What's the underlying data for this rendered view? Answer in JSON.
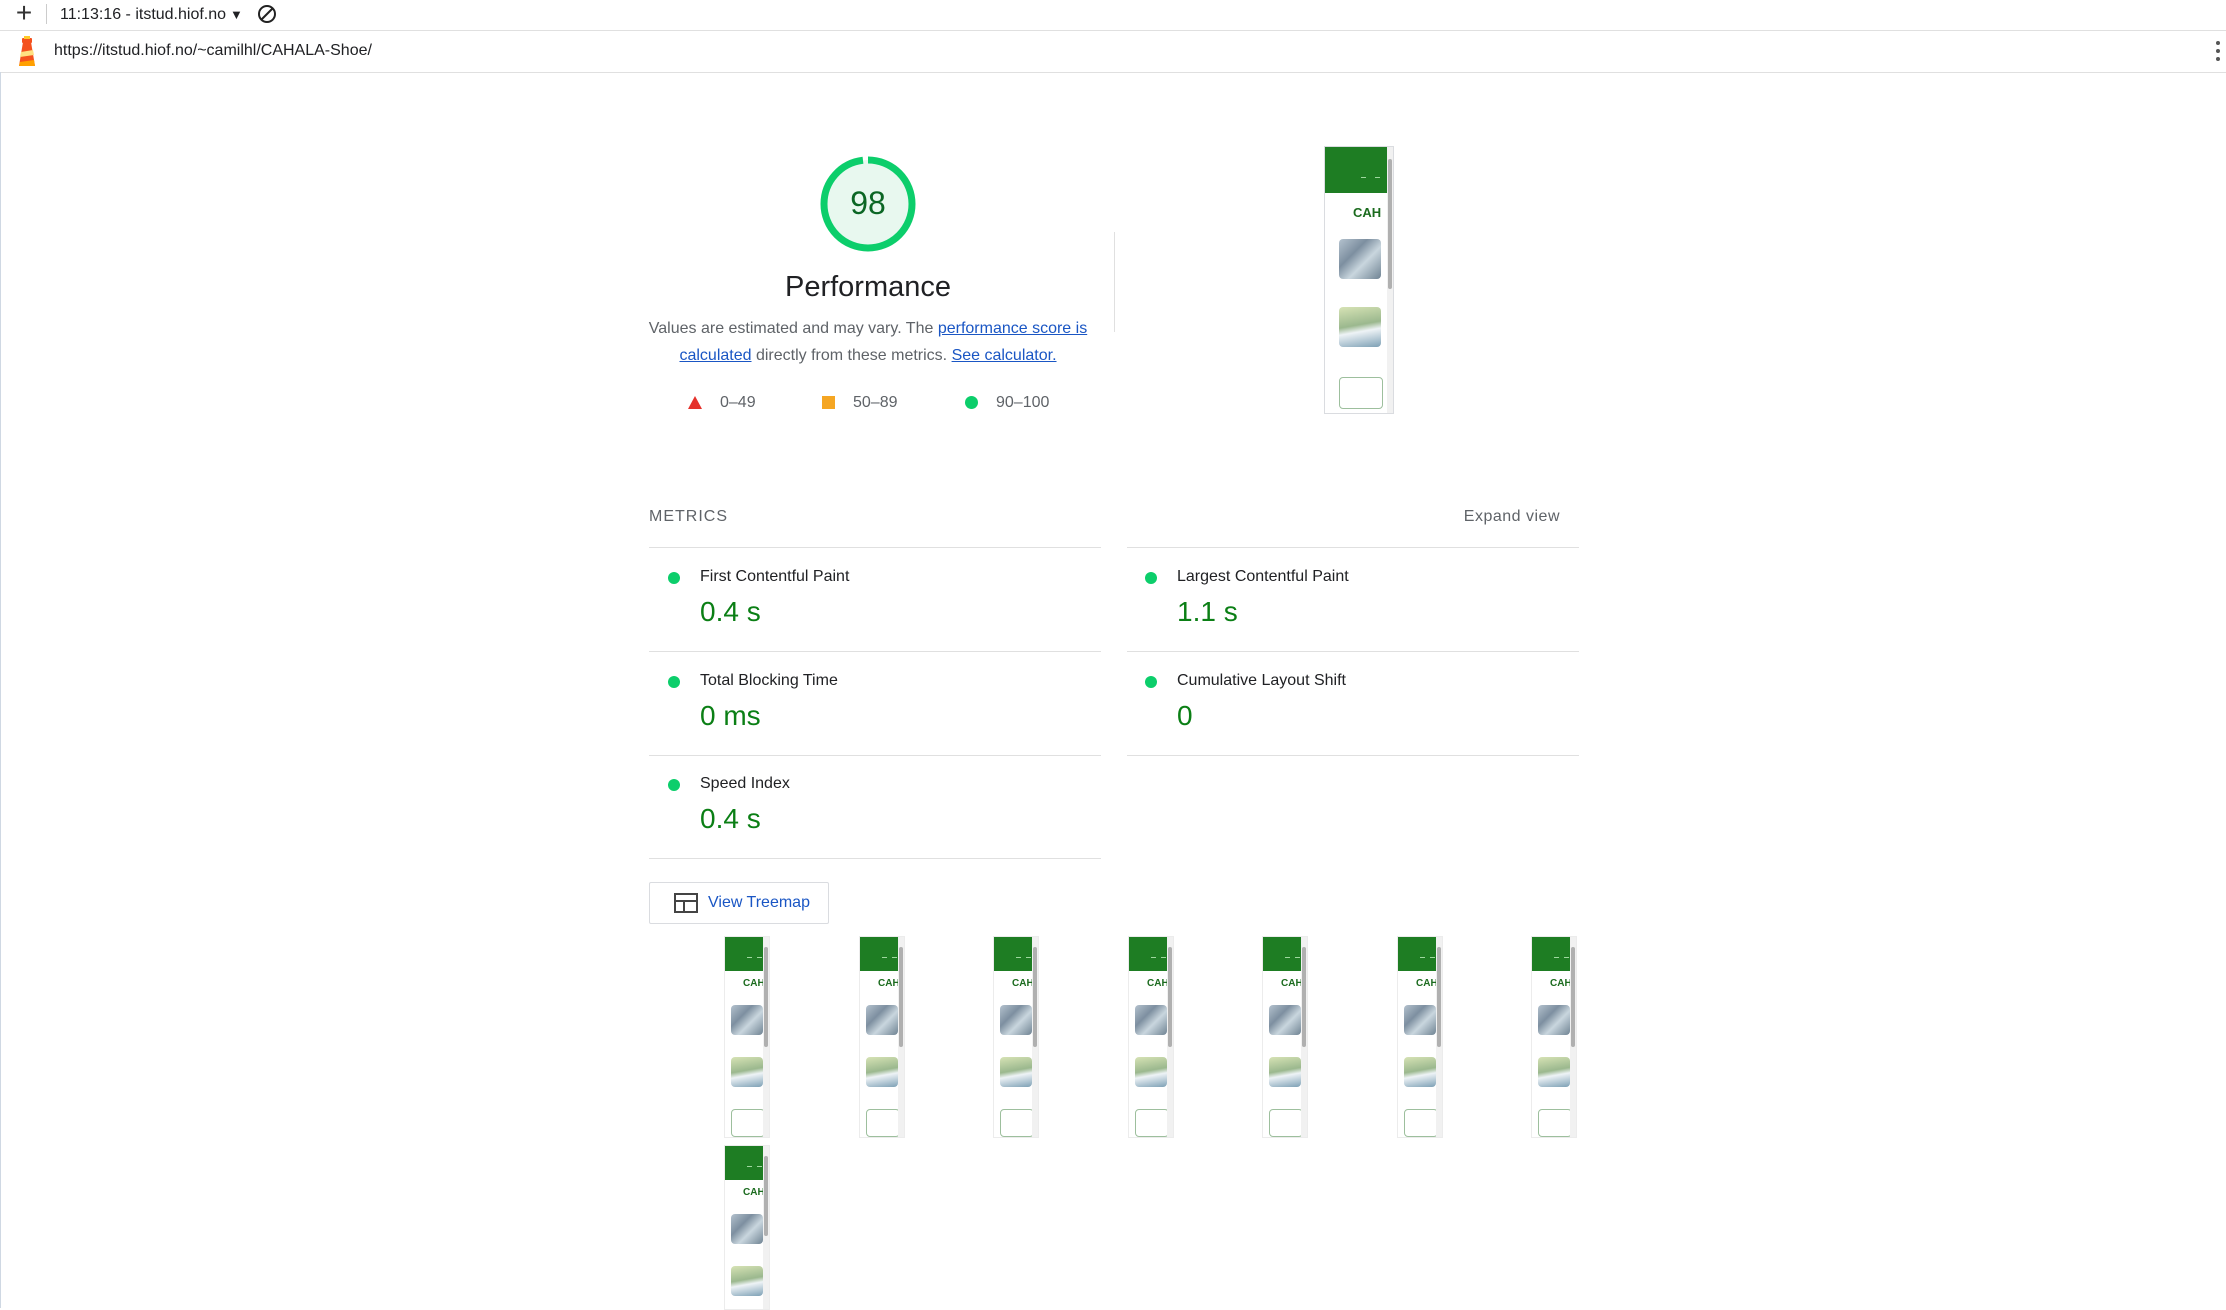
{
  "topbar": {
    "report_time": "11:13:16 - itstud.hiof.no",
    "caret": "▼",
    "plus_label": "+"
  },
  "urlbar": {
    "url": "https://itstud.hiof.no/~camilhl/CAHALA-Shoe/"
  },
  "score": {
    "value": 98,
    "value_text": "98",
    "title": "Performance",
    "rating_color": "#0cce6b",
    "description_prefix": "Values are estimated and may vary. The ",
    "description_link1": "performance score is calculated",
    "description_mid": " directly from these metrics. ",
    "description_link2": "See calculator."
  },
  "legend": {
    "fail": "0–49",
    "average": "50–89",
    "pass": "90–100",
    "fail_color": "#e5312b",
    "average_color": "#f5a623",
    "pass_color": "#0cce6b"
  },
  "metrics": {
    "section_label": "METRICS",
    "expand_label": "Expand view",
    "items": [
      {
        "name": "First Contentful Paint",
        "value": "0.4 s"
      },
      {
        "name": "Largest Contentful Paint",
        "value": "1.1 s"
      },
      {
        "name": "Total Blocking Time",
        "value": "0 ms"
      },
      {
        "name": "Cumulative Layout Shift",
        "value": "0"
      },
      {
        "name": "Speed Index",
        "value": "0.4 s"
      }
    ]
  },
  "treemap": {
    "label": "View Treemap"
  },
  "screenshot": {
    "thumb_text": "CAH"
  },
  "filmstrip": {
    "frame_text": "CAH",
    "frame_count": 8
  },
  "icons": {
    "plus": "plus-icon",
    "clear": "block-icon",
    "logo": "lighthouse-logo-icon",
    "menu": "more-vert-icon",
    "treemap": "treemap-icon"
  }
}
